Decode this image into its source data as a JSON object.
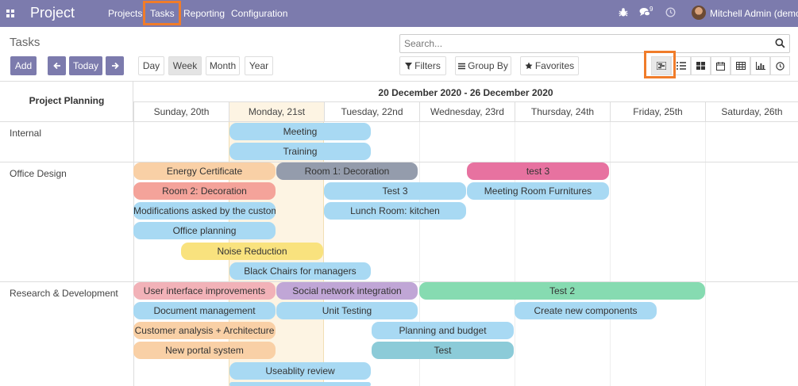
{
  "navbar": {
    "brand": "Project",
    "menu": [
      "Projects",
      "Tasks",
      "Reporting",
      "Configuration"
    ],
    "notif_count": "9",
    "user": "Mitchell Admin (demo)"
  },
  "control": {
    "breadcrumb": "Tasks",
    "search_placeholder": "Search...",
    "add": "Add",
    "today": "Today",
    "scales": [
      "Day",
      "Week",
      "Month",
      "Year"
    ],
    "active_scale": "Week",
    "filters": "Filters",
    "group_by": "Group By",
    "favorites": "Favorites"
  },
  "gantt": {
    "title": "Project Planning",
    "range": "20 December 2020 - 26 December 2020",
    "days": [
      "Sunday, 20th",
      "Monday, 21st",
      "Tuesday, 22nd",
      "Wednesday, 23rd",
      "Thursday, 24th",
      "Friday, 25th",
      "Saturday, 26th"
    ],
    "groups": [
      "Internal",
      "Office Design",
      "Research & Development"
    ],
    "tasks": {
      "meeting": "Meeting",
      "training": "Training",
      "energy": "Energy Certificate",
      "room1": "Room 1: Decoration",
      "test3b": "test 3",
      "room2": "Room 2: Decoration",
      "test3": "Test 3",
      "furnitures": "Meeting Room Furnitures",
      "modifications": "Modifications asked by the customer",
      "lunch": "Lunch Room: kitchen",
      "office_planning": "Office planning",
      "noise": "Noise Reduction",
      "chairs": "Black Chairs for managers",
      "ui": "User interface improvements",
      "social": "Social network integration",
      "test2": "Test 2",
      "docs": "Document management",
      "unit": "Unit Testing",
      "components": "Create new components",
      "customer": "Customer analysis + Architecture",
      "budget": "Planning and budget",
      "portal": "New portal system",
      "test": "Test",
      "usability": "Useablity review"
    }
  },
  "colors": {
    "navbar": "#7c7bad",
    "highlight": "#f07c2a",
    "blue": "#a8d9f3",
    "orange": "#f9d0a6",
    "grey": "#949cac",
    "pink": "#e772a0",
    "salmon": "#f4a39a",
    "yellow": "#f9e27e",
    "rose": "#f2b2b8",
    "purple": "#c0a6d6",
    "green": "#86dbb1",
    "teal": "#8ccbd8"
  }
}
